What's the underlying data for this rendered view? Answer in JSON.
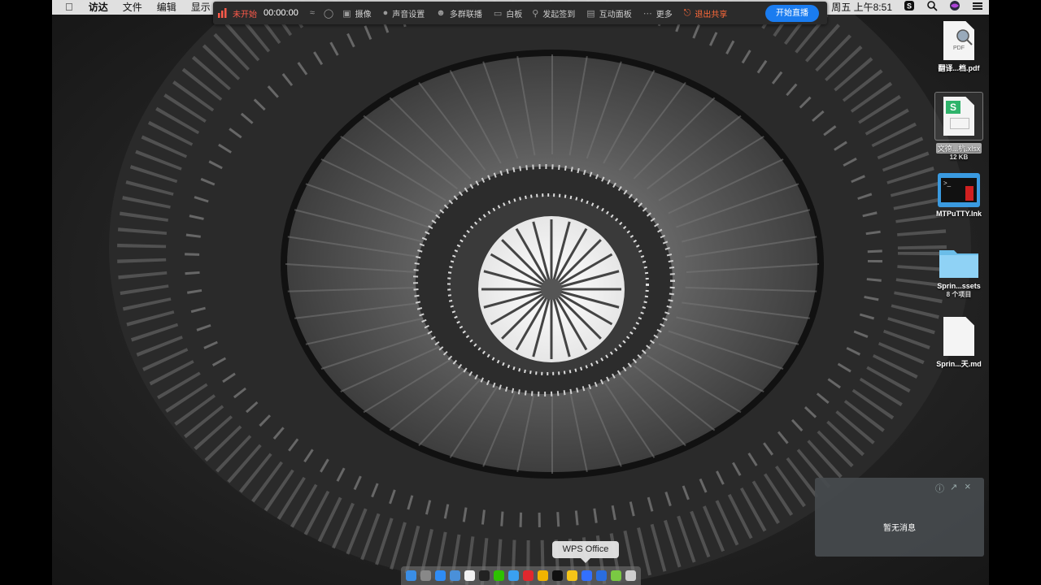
{
  "menubar": {
    "apple_icon": "apple-icon",
    "items": [
      "访达",
      "文件",
      "编辑",
      "显示"
    ],
    "clock": "周五 上午8:51",
    "right_icons": [
      "sogou-icon",
      "search-icon",
      "siri-icon",
      "control-center-icon"
    ]
  },
  "sharebar": {
    "status": "未开始",
    "timer": "00:00:00",
    "items": [
      {
        "icon": "wifi-icon",
        "label": ""
      },
      {
        "icon": "screen-icon",
        "label": ""
      },
      {
        "icon": "camera-icon",
        "label": "摄像"
      },
      {
        "icon": "mic-icon",
        "label": "声音设置"
      },
      {
        "icon": "people-icon",
        "label": "多群联播"
      },
      {
        "icon": "whiteboard-icon",
        "label": "白板"
      },
      {
        "icon": "location-icon",
        "label": "发起签到"
      },
      {
        "icon": "chat-icon",
        "label": "互动面板"
      },
      {
        "icon": "more-icon",
        "label": "更多"
      }
    ],
    "exit_label": "退出共享",
    "live_button": "开始直播"
  },
  "desktop": {
    "items": [
      {
        "label": "翻译...档.pdf",
        "sub": "",
        "icon": "pdf-file-icon",
        "badge": "PDF"
      },
      {
        "label": "文德...杭.xlsx",
        "sub": "12 KB",
        "icon": "xlsx-file-icon",
        "badge": "S"
      },
      {
        "label": "MTPuTTY.lnk",
        "sub": "",
        "icon": "mtputty-icon"
      },
      {
        "label": "Sprin...ssets",
        "sub": "8 个项目",
        "icon": "folder-icon"
      },
      {
        "label": "Sprin...天.md",
        "sub": "",
        "icon": "markdown-file-icon"
      }
    ]
  },
  "notification": {
    "message": "暂无消息",
    "help_icon": "help-icon",
    "expand_icon": "expand-icon",
    "close_icon": "close-icon"
  },
  "tooltip": {
    "text": "WPS Office"
  },
  "dock": {
    "apps": [
      {
        "name": "finder-icon",
        "color": "#3a8ee6"
      },
      {
        "name": "launchpad-icon",
        "color": "#888888"
      },
      {
        "name": "app-store-icon",
        "color": "#2f8cf5"
      },
      {
        "name": "preview-icon",
        "color": "#4a90d9"
      },
      {
        "name": "calendar-icon",
        "color": "#f2f2f2"
      },
      {
        "name": "terminal-icon",
        "color": "#222222"
      },
      {
        "name": "wechat-icon",
        "color": "#2dc100"
      },
      {
        "name": "safari-icon",
        "color": "#3aa0f0"
      },
      {
        "name": "netease-music-icon",
        "color": "#e0282e"
      },
      {
        "name": "qq-browser-icon",
        "color": "#f0b400"
      },
      {
        "name": "qq-icon",
        "color": "#111111"
      },
      {
        "name": "chrome-icon",
        "color": "#f5c518"
      },
      {
        "name": "feishu-icon",
        "color": "#3370ff"
      },
      {
        "name": "wps-icon",
        "color": "#2a6de0"
      },
      {
        "name": "maps-icon",
        "color": "#7ac943"
      },
      {
        "name": "trash-icon",
        "color": "#cfcfcf"
      }
    ]
  }
}
